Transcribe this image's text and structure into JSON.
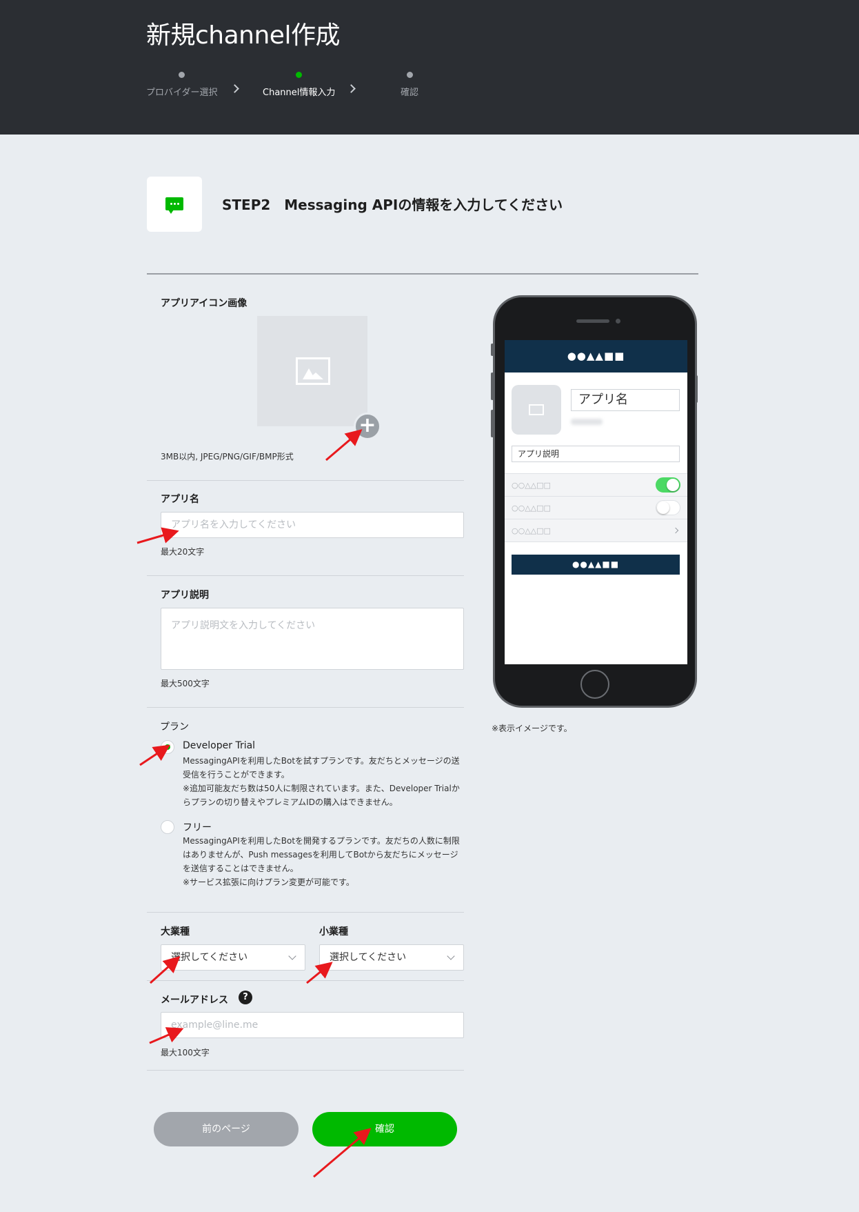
{
  "header": {
    "title": "新規channel作成",
    "steps": [
      {
        "label": "プロバイダー選択",
        "active": false
      },
      {
        "label": "Channel情報入力",
        "active": true
      },
      {
        "label": "確認",
        "active": false
      }
    ]
  },
  "step": {
    "heading": "STEP2　Messaging APIの情報を入力してください"
  },
  "form": {
    "app_icon": {
      "label": "アプリアイコン画像",
      "note": "3MB以内, JPEG/PNG/GIF/BMP形式",
      "plus": "+"
    },
    "app_name": {
      "label": "アプリ名",
      "placeholder": "アプリ名を入力してください",
      "value": "",
      "note": "最大20文字"
    },
    "app_desc": {
      "label": "アプリ説明",
      "placeholder": "アプリ説明文を入力してください",
      "value": "",
      "note": "最大500文字"
    },
    "plan": {
      "label": "プラン",
      "options": [
        {
          "title": "Developer Trial",
          "selected": true,
          "desc": "MessagingAPIを利用したBotを試すプランです。友だちとメッセージの送受信を行うことができます。",
          "note": "※追加可能友だち数は50人に制限されています。また、Developer Trialからプランの切り替えやプレミアムIDの購入はできません。"
        },
        {
          "title": "フリー",
          "selected": false,
          "desc": "MessagingAPIを利用したBotを開発するプランです。友だちの人数に制限はありませんが、Push messagesを利用してBotから友だちにメッセージを送信することはできません。",
          "note": "※サービス拡張に向けプラン変更が可能です。"
        }
      ]
    },
    "industry_major": {
      "label": "大業種",
      "selected": "選択してください"
    },
    "industry_minor": {
      "label": "小業種",
      "selected": "選択してください"
    },
    "email": {
      "label": "メールアドレス",
      "help": "?",
      "placeholder": "example@line.me",
      "value": "",
      "note": "最大100文字"
    },
    "buttons": {
      "back": "前のページ",
      "confirm": "確認"
    }
  },
  "preview": {
    "header_title": "●●▲▲■■",
    "app_name": "アプリ名",
    "app_desc": "アプリ説明",
    "rows": [
      {
        "label": "○○△△□□",
        "control": "toggle-on"
      },
      {
        "label": "○○△△□□",
        "control": "toggle-off"
      },
      {
        "label": "○○△△□□",
        "control": "chevron"
      }
    ],
    "button_label": "●●▲▲■■",
    "note": "※表示イメージです。"
  },
  "colors": {
    "header_bg": "#2b2e33",
    "page_bg": "#e9edf1",
    "accent_green": "#00b900",
    "preview_navy": "#10304a",
    "annotation_red": "#e8191d"
  }
}
